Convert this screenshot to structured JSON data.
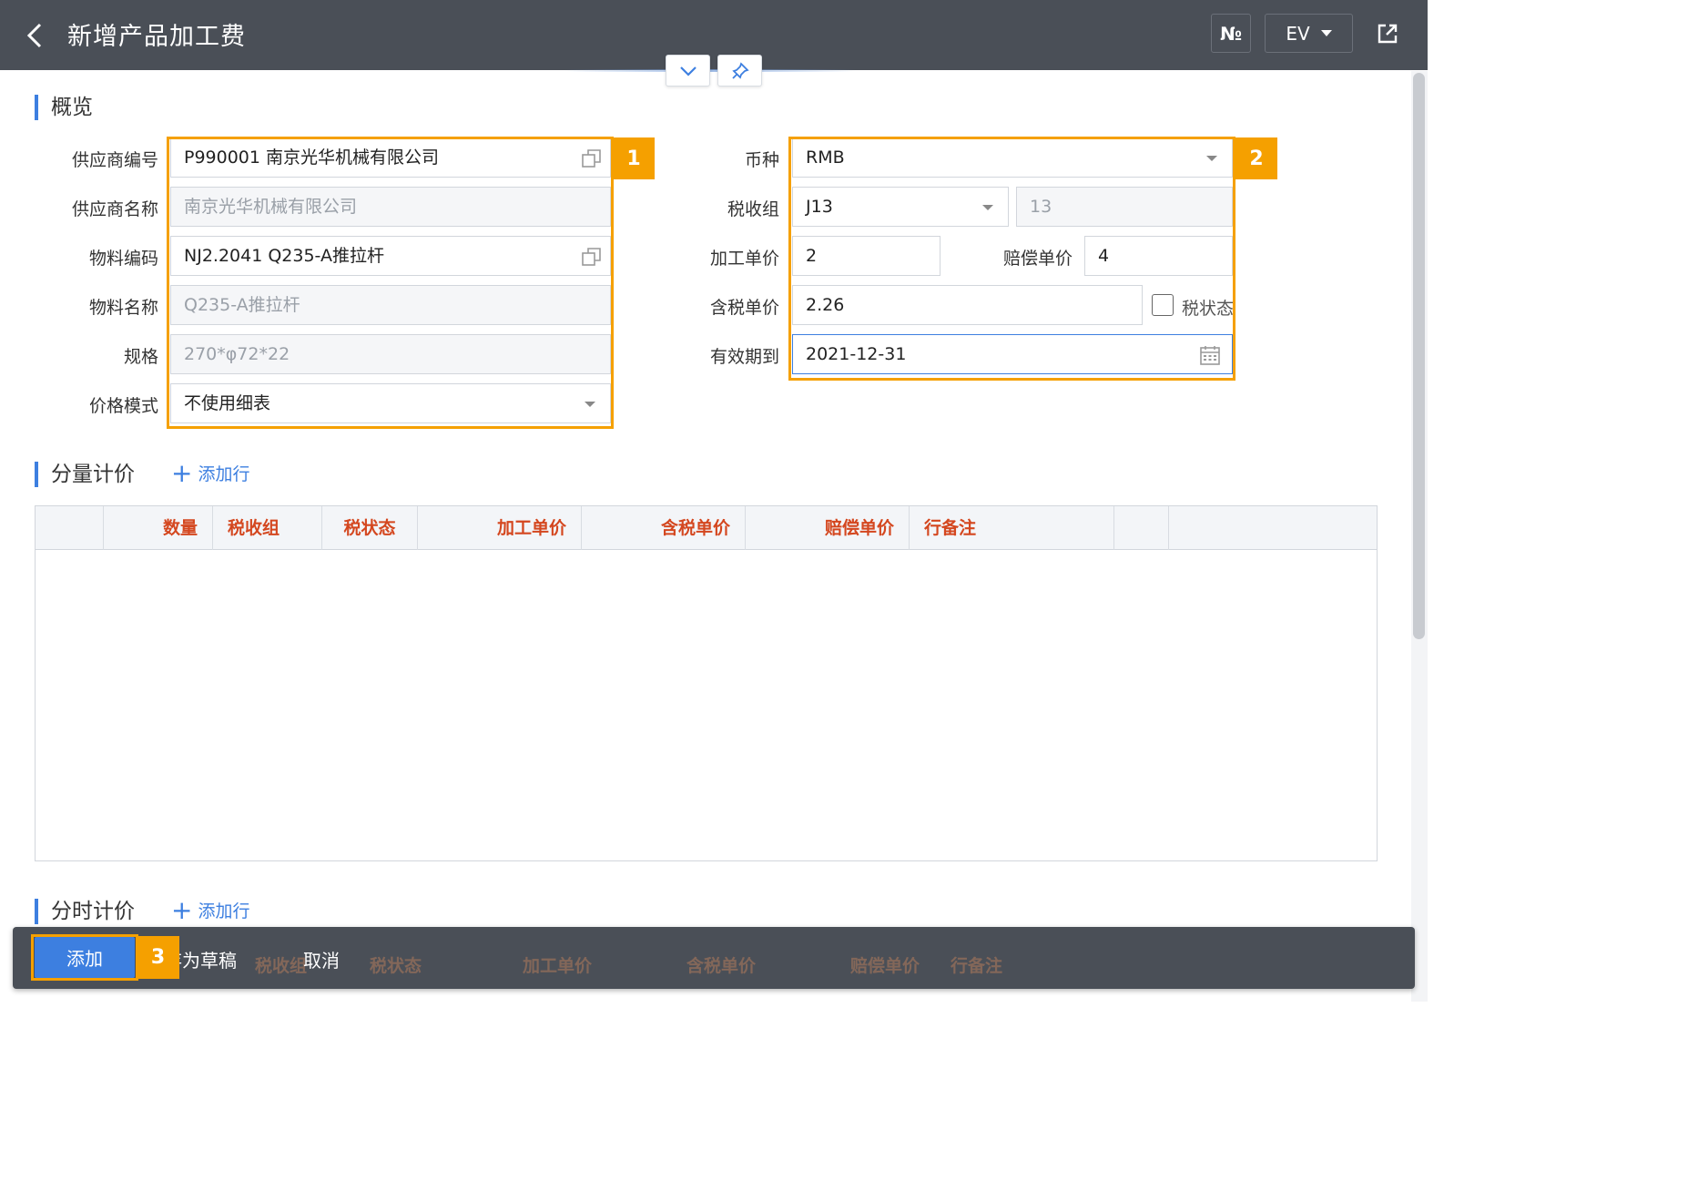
{
  "header": {
    "title": "新增产品加工费",
    "no_button": "№",
    "lang_button": "EV"
  },
  "overview": {
    "title": "概览",
    "fields": {
      "supplier_code_label": "供应商编号",
      "supplier_code_value": "P990001 南京光华机械有限公司",
      "supplier_name_label": "供应商名称",
      "supplier_name_value": "南京光华机械有限公司",
      "material_code_label": "物料编码",
      "material_code_value": "NJ2.2041 Q235-A推拉杆",
      "material_name_label": "物料名称",
      "material_name_value": "Q235-A推拉杆",
      "spec_label": "规格",
      "spec_value": "270*φ72*22",
      "price_mode_label": "价格模式",
      "price_mode_value": "不使用细表",
      "currency_label": "币种",
      "currency_value": "RMB",
      "tax_group_label": "税收组",
      "tax_group_value": "J13",
      "tax_rate_value": "13",
      "process_price_label": "加工单价",
      "process_price_value": "2",
      "comp_price_label": "赔偿单价",
      "comp_price_value": "4",
      "tax_incl_price_label": "含税单价",
      "tax_incl_price_value": "2.26",
      "tax_status_label": "税状态",
      "tax_status_checked": false,
      "valid_until_label": "有效期到",
      "valid_until_value": "2021-12-31"
    }
  },
  "highlights": {
    "one": "1",
    "two": "2",
    "three": "3"
  },
  "qty_pricing": {
    "title": "分量计价",
    "add_row": "添加行",
    "columns": [
      "数量",
      "税收组",
      "税状态",
      "加工单价",
      "含税单价",
      "赔偿单价",
      "行备注"
    ]
  },
  "time_pricing": {
    "title": "分时计价",
    "add_row": "添加行",
    "columns": [
      "税收组",
      "税状态",
      "加工单价",
      "含税单价",
      "赔偿单价",
      "行备注"
    ]
  },
  "actions": {
    "add": "添加",
    "save_draft": "存为草稿",
    "cancel": "取消"
  },
  "colors": {
    "accent": "#3d7fe0",
    "highlight": "#f5a000",
    "header_bg": "#4a4f57",
    "column_text": "#d4471f"
  }
}
